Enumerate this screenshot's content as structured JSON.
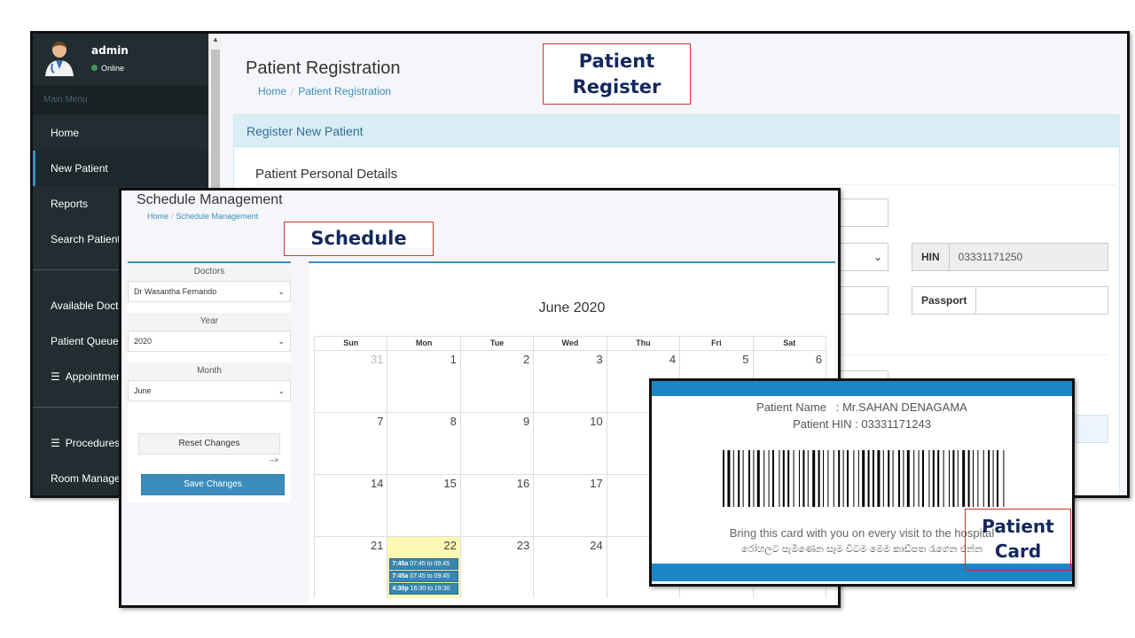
{
  "sidebar": {
    "user": {
      "name": "admin",
      "status": "Online"
    },
    "menu_header": "Main Menu",
    "items": [
      {
        "label": "Home"
      },
      {
        "label": "New Patient"
      },
      {
        "label": "Reports"
      },
      {
        "label": "Search Patients"
      },
      {
        "label": "Available Doctors"
      },
      {
        "label": "Patient Queue"
      },
      {
        "label": "Appointments",
        "icon": "list-icon"
      },
      {
        "label": "Procedures",
        "icon": "list-icon"
      },
      {
        "label": "Room Management"
      }
    ]
  },
  "registration": {
    "title": "Patient Registration",
    "breadcrumb": [
      "Home",
      "Patient Registration"
    ],
    "box_title": "Register New Patient",
    "section_title": "Patient Personal Details",
    "hin_label": "HIN",
    "hin_value": "03331171250",
    "passport_label": "Passport"
  },
  "schedule": {
    "title": "Schedule Management",
    "breadcrumb": [
      "Home",
      "Schedule Management"
    ],
    "doctors_label": "Doctors",
    "doctor_value": "Dr Wasantha Fernando",
    "year_label": "Year",
    "year_value": "2020",
    "month_label": "Month",
    "month_value": "June",
    "reset_label": "Reset Changes",
    "arrow_text": "-->",
    "save_label": "Save Changes",
    "calendar": {
      "title": "June 2020",
      "weekdays": [
        "Sun",
        "Mon",
        "Tue",
        "Wed",
        "Thu",
        "Fri",
        "Sat"
      ],
      "rows": [
        [
          "31",
          "1",
          "2",
          "3",
          "4",
          "5",
          "6"
        ],
        [
          "7",
          "8",
          "9",
          "10",
          "",
          "",
          ""
        ],
        [
          "14",
          "15",
          "16",
          "17",
          "",
          "",
          ""
        ],
        [
          "21",
          "22",
          "23",
          "24",
          "",
          "",
          ""
        ]
      ],
      "events": [
        {
          "time": "7:45a",
          "range": "07:45 to 09:45"
        },
        {
          "time": "7:45a",
          "range": "07:45 to 09:45"
        },
        {
          "time": "4:30p",
          "range": "16:30 to 19:30"
        }
      ]
    }
  },
  "card": {
    "name_line": "Patient Name   : Mr.SAHAN DENAGAMA",
    "hin_line": "Patient HIN : 03331171243",
    "message": "Bring this card with you on every visit to the hospital",
    "message_si": "රෝහලට පැමිණෙන සෑම විටම මෙම කාඩ්පත රැගෙන එන්න"
  },
  "callouts": {
    "register": [
      "Patient",
      "Register"
    ],
    "schedule": "Schedule",
    "card": [
      "Patient",
      "Card"
    ]
  },
  "colors": {
    "sidebar_bg": "#222d32",
    "accent": "#3c8dbc",
    "callout_text": "#13285c",
    "callout_border": "#c9342c",
    "today_bg": "#fcf8b3",
    "card_bar": "#1a86c8"
  }
}
